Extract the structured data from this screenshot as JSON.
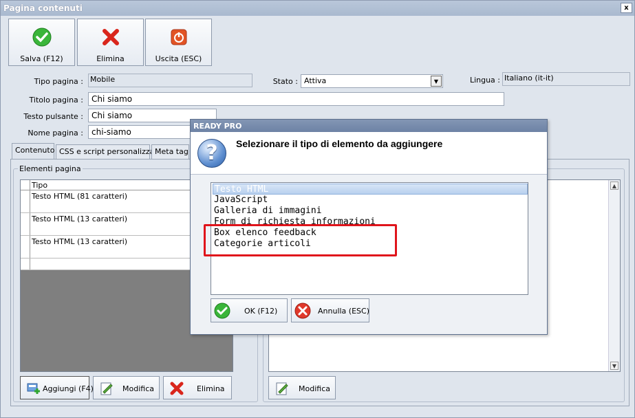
{
  "window": {
    "title": "Pagina contenuti",
    "close_glyph": "x"
  },
  "toolbar": {
    "save_label": "Salva (F12)",
    "delete_label": "Elimina",
    "exit_label": "Uscita (ESC)"
  },
  "form": {
    "tipo_label": "Tipo pagina :",
    "tipo_value": "Mobile",
    "stato_label": "Stato :",
    "stato_value": "Attiva",
    "lingua_label": "Lingua :",
    "lingua_value": "Italiano (it-it)",
    "titolo_label": "Titolo pagina :",
    "titolo_value": "Chi siamo",
    "testo_label": "Testo pulsante :",
    "testo_value": "Chi siamo",
    "nome_label": "Nome pagina :",
    "nome_value": "chi-siamo"
  },
  "tabs": [
    {
      "label": "Contenuto"
    },
    {
      "label": "CSS e script personalizzati"
    },
    {
      "label": "Meta tag"
    }
  ],
  "elements": {
    "group_title": "Elementi pagina",
    "column_header": "Tipo",
    "rows": [
      "Testo HTML (81 caratteri)",
      "Testo HTML (13 caratteri)",
      "Testo HTML (13 caratteri)"
    ],
    "add_label": "Aggiungi (F4)",
    "edit_label": "Modifica",
    "delete_label": "Elimina"
  },
  "preview": {
    "edit_label": "Modifica"
  },
  "dialog": {
    "title": "READY PRO",
    "message": "Selezionare il tipo di elemento da aggiungere",
    "icon_glyph": "?",
    "options": [
      "Testo HTML",
      "JavaScript",
      "Galleria di immagini",
      "Form di richiesta informazioni",
      "Box elenco feedback",
      "Categorie articoli"
    ],
    "selected_index": 0,
    "ok_label": "OK (F12)",
    "cancel_label": "Annulla (ESC)"
  },
  "colors": {
    "highlight_box": "#e0141b",
    "titlebar": "#b0bfd5"
  }
}
